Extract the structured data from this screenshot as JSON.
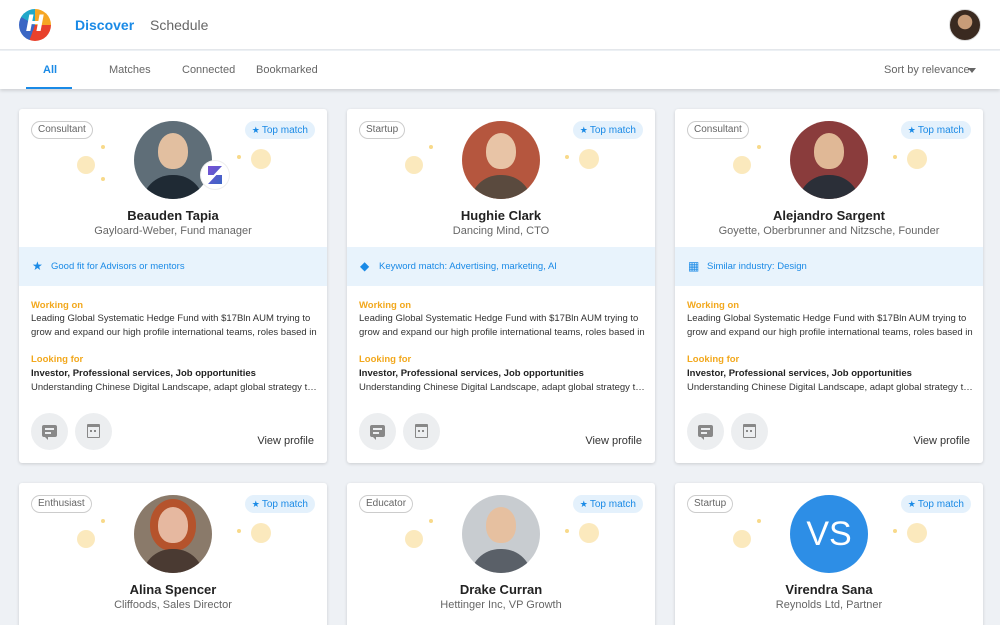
{
  "nav": {
    "tabs": [
      {
        "label": "Discover"
      },
      {
        "label": "Schedule"
      }
    ]
  },
  "filters": {
    "tabs": [
      {
        "label": "All"
      },
      {
        "label": "Matches"
      },
      {
        "label": "Connected"
      },
      {
        "label": "Bookmarked"
      }
    ],
    "sort_label": "Sort by relevance"
  },
  "colors": {
    "accent": "#1a8ae6",
    "highlight": "#f2a81d",
    "match_strip": "#e8f3fc"
  },
  "labels": {
    "top_match": "Top match",
    "working_on": "Working on",
    "looking_for": "Looking for",
    "view_profile": "View profile"
  },
  "cards": [
    {
      "type": "Consultant",
      "name": "Beauden Tapia",
      "role": "Gayloard-Weber, Fund manager",
      "match_icon": "star-icon",
      "match_text": "Good fit for Advisors or mentors",
      "working_on": "Leading Global Systematic Hedge Fund with $17Bln AUM trying to grow and expand our high profile international teams, roles based in Hong Kong and Singapore.",
      "looking_for_tags": "Investor, Professional services, Job opportunities",
      "looking_for": "Understanding Chinese Digital Landscape, adapt global strategy to China."
    },
    {
      "type": "Startup",
      "name": "Hughie Clark",
      "role": "Dancing Mind, CTO",
      "match_icon": "tag-icon",
      "match_text": "Keyword match: Advertising, marketing, AI",
      "working_on": "Leading Global Systematic Hedge Fund with $17Bln AUM trying to grow and expand our high profile international teams, roles based in Hong Kong and Singapore.",
      "looking_for_tags": "Investor, Professional services, Job opportunities",
      "looking_for": "Understanding Chinese Digital Landscape, adapt global strategy to China."
    },
    {
      "type": "Consultant",
      "name": "Alejandro Sargent",
      "role": "Goyette, Oberbrunner and Nitzsche, Founder",
      "match_icon": "building-icon",
      "match_text": "Similar industry: Design",
      "working_on": "Leading Global Systematic Hedge Fund with $17Bln AUM trying to grow and expand our high profile international teams, roles based in Hong Kong and Singapore.",
      "looking_for_tags": "Investor, Professional services, Job opportunities",
      "looking_for": "Understanding Chinese Digital Landscape, adapt global strategy to China."
    },
    {
      "type": "Enthusiast",
      "name": "Alina Spencer",
      "role": "Cliffoods, Sales Director"
    },
    {
      "type": "Educator",
      "name": "Drake Curran",
      "role": "Hettinger Inc, VP Growth"
    },
    {
      "type": "Startup",
      "name": "Virendra Sana",
      "role": "Reynolds Ltd, Partner",
      "initials": "VS"
    }
  ]
}
